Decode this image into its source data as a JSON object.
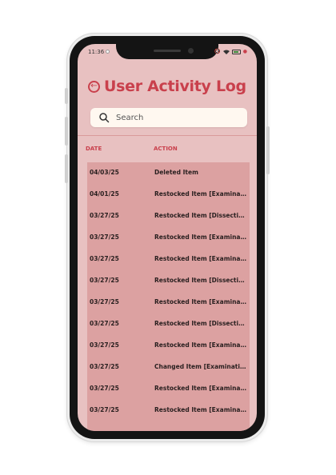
{
  "status_bar": {
    "time": "11:36"
  },
  "header": {
    "title": "User Activity Log",
    "back_icon": "back-arrow-circle-icon"
  },
  "search": {
    "placeholder": "Search",
    "value": "",
    "icon": "search-icon"
  },
  "table": {
    "columns": [
      "DATE",
      "ACTION"
    ],
    "rows": [
      {
        "date": "04/03/25",
        "action": "Deleted Item"
      },
      {
        "date": "04/01/25",
        "action": "Restocked Item [Examinati..."
      },
      {
        "date": "03/27/25",
        "action": "Restocked Item [Dissecting ..."
      },
      {
        "date": "03/27/25",
        "action": "Restocked Item [Examinati..."
      },
      {
        "date": "03/27/25",
        "action": "Restocked Item [Examinati..."
      },
      {
        "date": "03/27/25",
        "action": "Restocked Item [Dissecting ..."
      },
      {
        "date": "03/27/25",
        "action": "Restocked Item [Examinati..."
      },
      {
        "date": "03/27/25",
        "action": "Restocked Item [Dissecting ..."
      },
      {
        "date": "03/27/25",
        "action": "Restocked Item [Examinati..."
      },
      {
        "date": "03/27/25",
        "action": "Changed Item [Examinatio..."
      },
      {
        "date": "03/27/25",
        "action": "Restocked Item [Examinati..."
      },
      {
        "date": "03/27/25",
        "action": "Restocked Item [Examinati..."
      }
    ]
  },
  "colors": {
    "accent": "#c9404c",
    "screen_bg": "#e8c1c1",
    "table_bg": "#dca1a1",
    "search_bg": "#fff8f0"
  }
}
